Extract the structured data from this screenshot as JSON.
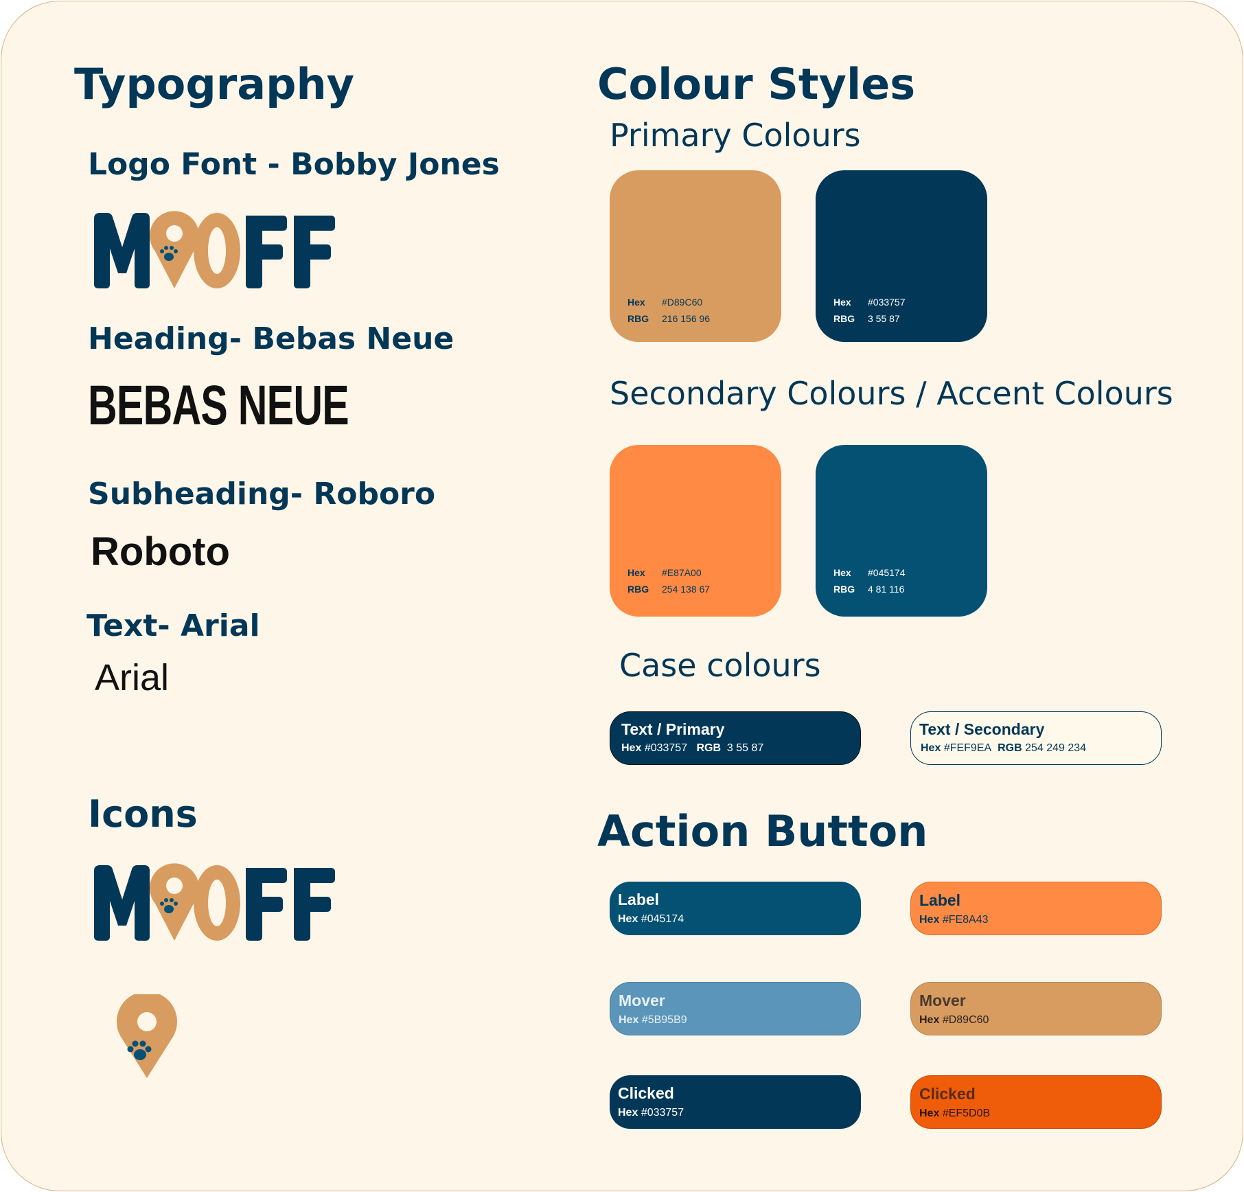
{
  "typography": {
    "title": "Typography",
    "logo_font_label": "Logo Font - Bobby Jones",
    "logo_text": "MOOFF",
    "heading_label": "Heading- Bebas Neue",
    "heading_sample": "BEBAS NEUE",
    "subheading_label": "Subheading- Roboro",
    "subheading_sample": "Roboto",
    "text_label": "Text- Arial",
    "text_sample": "Arial"
  },
  "icons": {
    "title": "Icons",
    "logo_text": "MOOFF"
  },
  "colour_styles": {
    "title": "Colour Styles",
    "primary_title": "Primary Colours",
    "secondary_title": "Secondary Colours / Accent Colours",
    "case_title": "Case colours",
    "hex_key": "Hex",
    "rgb_key": "RBG",
    "primary": [
      {
        "hex": "#D89C60",
        "rgb": "216 156 96",
        "color": "#D89C60",
        "text_color": "#033757"
      },
      {
        "hex": "#033757",
        "rgb": "3 55 87",
        "color": "#033757",
        "text_color": "#ffffff"
      }
    ],
    "secondary": [
      {
        "hex": "#E87A00",
        "rgb": "254 138 67",
        "color": "#FE8A43",
        "text_color": "#033757"
      },
      {
        "hex": "#045174",
        "rgb": "4 81 116",
        "color": "#045174",
        "text_color": "#ffffff"
      }
    ],
    "case": [
      {
        "title": "Text / Primary",
        "hex_key": "Hex",
        "hex": "#033757",
        "rgb_key": "RGB",
        "rgb": "3 55 87"
      },
      {
        "title": "Text / Secondary",
        "hex_key": "Hex",
        "hex": "#FEF9EA",
        "rgb_key": "RGB",
        "rgb": "254 249 234"
      }
    ]
  },
  "action_button": {
    "title": "Action Button",
    "hex_key": "Hex",
    "buttons": [
      {
        "label": "Label",
        "hex": "#045174",
        "color": "#045174"
      },
      {
        "label": "Label",
        "hex": "#FE8A43",
        "color": "#FE8A43"
      },
      {
        "label": "Mover",
        "hex": "#5B95B9",
        "color": "#5B95B9"
      },
      {
        "label": "Mover",
        "hex": "#D89C60",
        "color": "#D89C60"
      },
      {
        "label": "Clicked",
        "hex": "#033757",
        "color": "#033757"
      },
      {
        "label": "Clicked",
        "hex": "#EF5D0B",
        "color": "#EF5D0B"
      }
    ]
  }
}
